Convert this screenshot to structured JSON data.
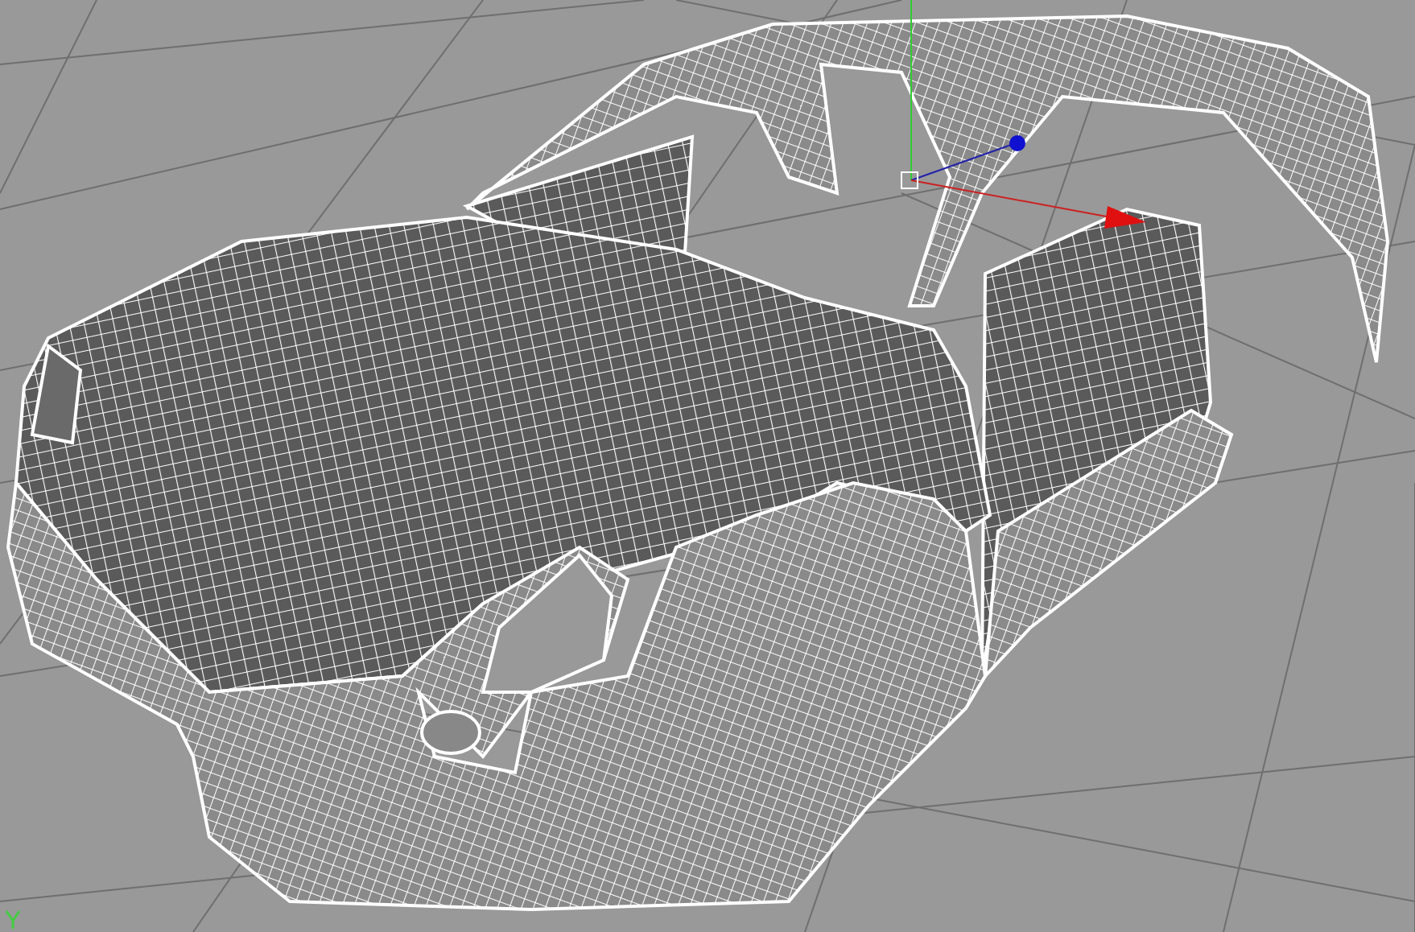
{
  "viewport": {
    "grid": true,
    "gizmo": true
  }
}
